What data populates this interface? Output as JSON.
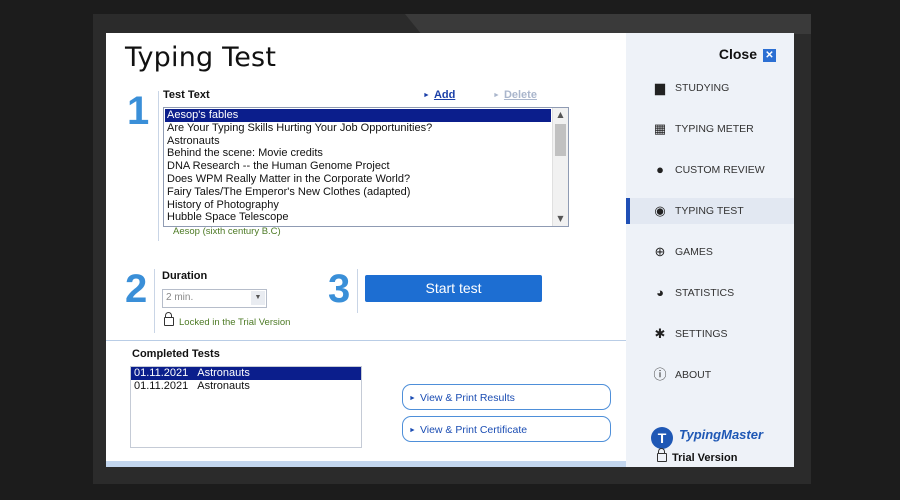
{
  "window": {
    "title": "Typing Test"
  },
  "steps": {
    "one": "1",
    "two": "2",
    "three": "3"
  },
  "test_text": {
    "label": "Test Text",
    "add_label": "Add",
    "delete_label": "Delete",
    "items": [
      "Aesop's fables",
      "Are Your Typing Skills Hurting Your Job Opportunities?",
      "Astronauts",
      "Behind the scene: Movie credits",
      "DNA Research -- the Human Genome Project",
      "Does WPM Really Matter in the Corporate World?",
      "Fairy Tales/The Emperor's New Clothes (adapted)",
      "History of Photography",
      "Hubble Space Telescope"
    ],
    "selected_index": 0,
    "author": "Aesop (sixth century B.C)"
  },
  "duration": {
    "label": "Duration",
    "value": "2 min.",
    "locked_note": "Locked in the Trial Version"
  },
  "start_button": {
    "label": "Start test"
  },
  "completed": {
    "label": "Completed Tests",
    "rows": [
      {
        "date": "01.11.2021",
        "name": "Astronauts"
      },
      {
        "date": "01.11.2021",
        "name": "Astronauts"
      }
    ]
  },
  "actions": {
    "view_results": "View & Print Results",
    "view_certificate": "View & Print Certificate"
  },
  "sidebar": {
    "close_label": "Close",
    "items": [
      {
        "label": "STUDYING",
        "icon": "briefcase-icon",
        "active": false
      },
      {
        "label": "TYPING METER",
        "icon": "calculator-icon",
        "active": false
      },
      {
        "label": "CUSTOM REVIEW",
        "icon": "person-icon",
        "active": false
      },
      {
        "label": "TYPING TEST",
        "icon": "target-icon",
        "active": true
      },
      {
        "label": "GAMES",
        "icon": "globe-icon",
        "active": false
      },
      {
        "label": "STATISTICS",
        "icon": "pie-chart-icon",
        "active": false
      },
      {
        "label": "SETTINGS",
        "icon": "gear-icon",
        "active": false
      },
      {
        "label": "ABOUT",
        "icon": "info-icon",
        "active": false
      }
    ],
    "brand": "TypingMaster",
    "trial": "Trial Version"
  },
  "colors": {
    "accent": "#1d6ed2",
    "selection": "#0b1e8c",
    "step_number": "#3a8fd8",
    "note_green": "#4d7a25"
  }
}
